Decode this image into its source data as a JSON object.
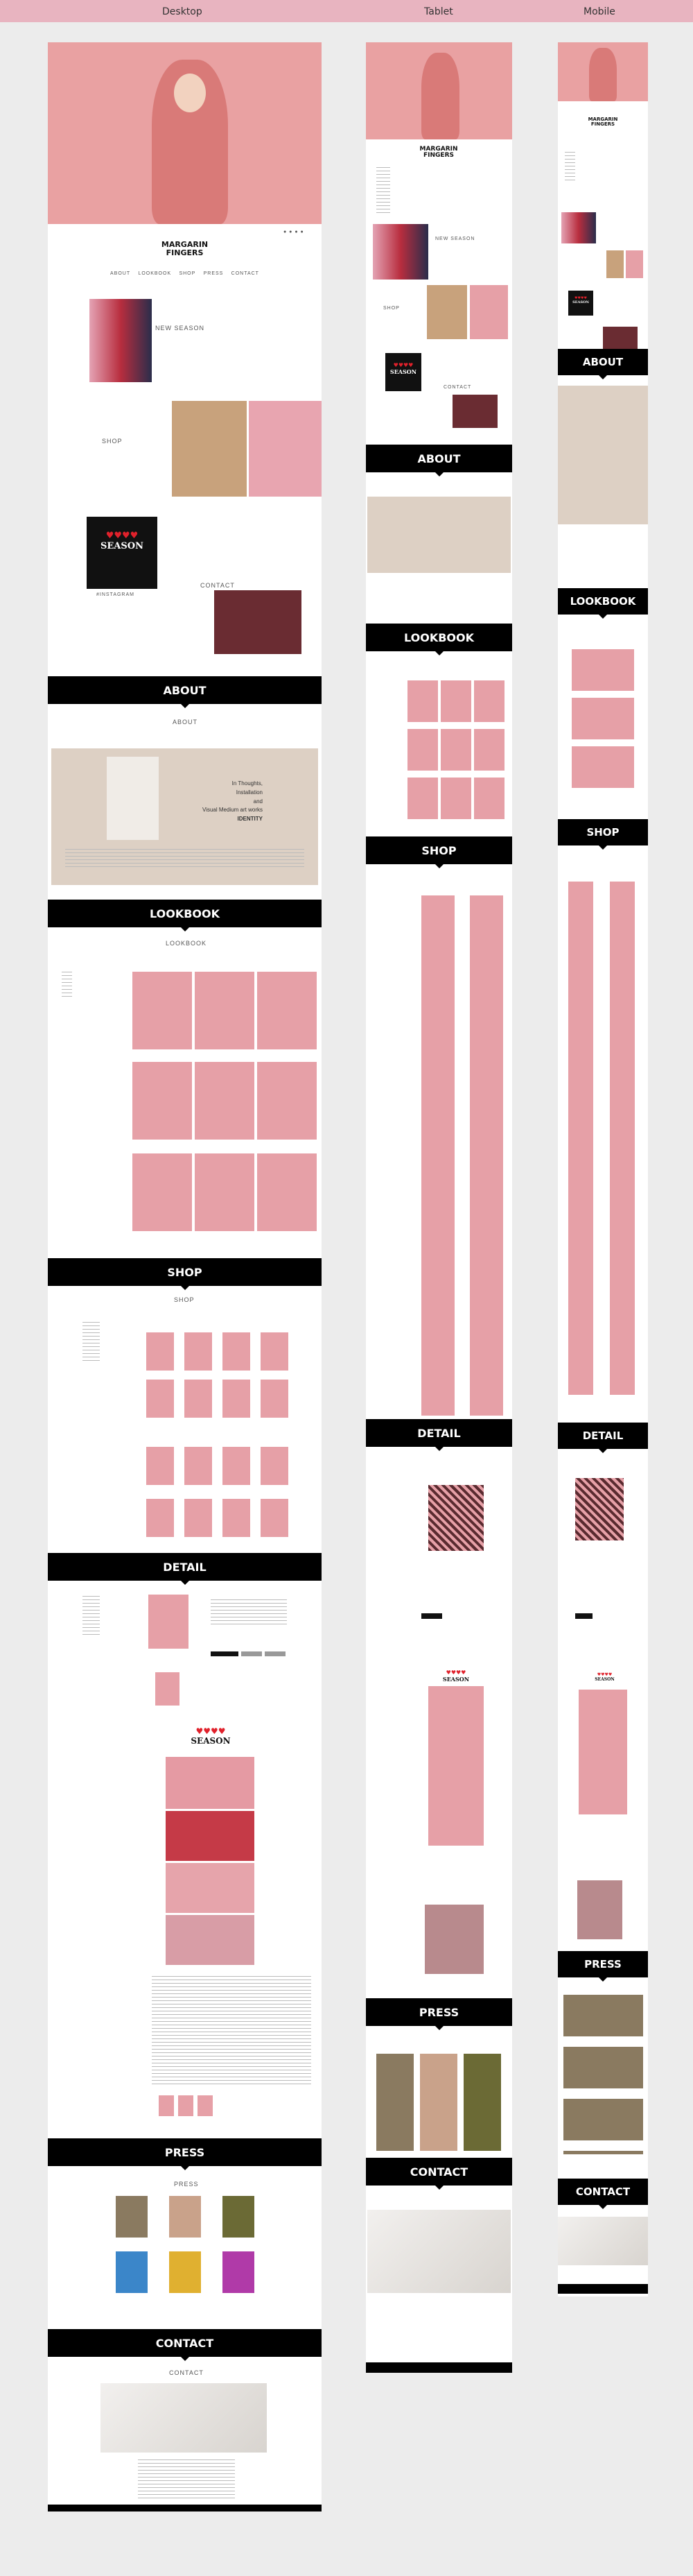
{
  "headers": {
    "desktop": "Desktop",
    "tablet": "Tablet",
    "mobile": "Mobile"
  },
  "brand": {
    "logo_line1": "MARGARIN",
    "logo_line2": "FINGERS"
  },
  "nav": {
    "items": [
      "ABOUT",
      "LOOKBOOK",
      "SHOP",
      "PRESS",
      "CONTACT"
    ]
  },
  "home": {
    "new_season": "NEW SEASON",
    "shop": "SHOP",
    "contact": "CONTACT",
    "instagram": "#INSTAGRAM"
  },
  "season_card": {
    "hearts": "♥♥♥♥",
    "word": "SEASON"
  },
  "sections": {
    "about": "ABOUT",
    "lookbook": "LOOKBOOK",
    "shop": "SHOP",
    "detail": "DETAIL",
    "press": "PRESS",
    "contact": "CONTACT"
  },
  "subtitles": {
    "about": "ABOUT",
    "lookbook": "LOOKBOOK",
    "shop": "SHOP",
    "press": "PRESS",
    "contact": "CONTACT"
  },
  "about_card": {
    "line1": "In Thoughts,",
    "line2": "Installation",
    "line3": "and",
    "line4": "Visual Medium art works",
    "line5": "IDENTITY"
  },
  "colors": {
    "accent": "#e8b4c0",
    "pink": "#e9a1a2",
    "black": "#000000"
  }
}
